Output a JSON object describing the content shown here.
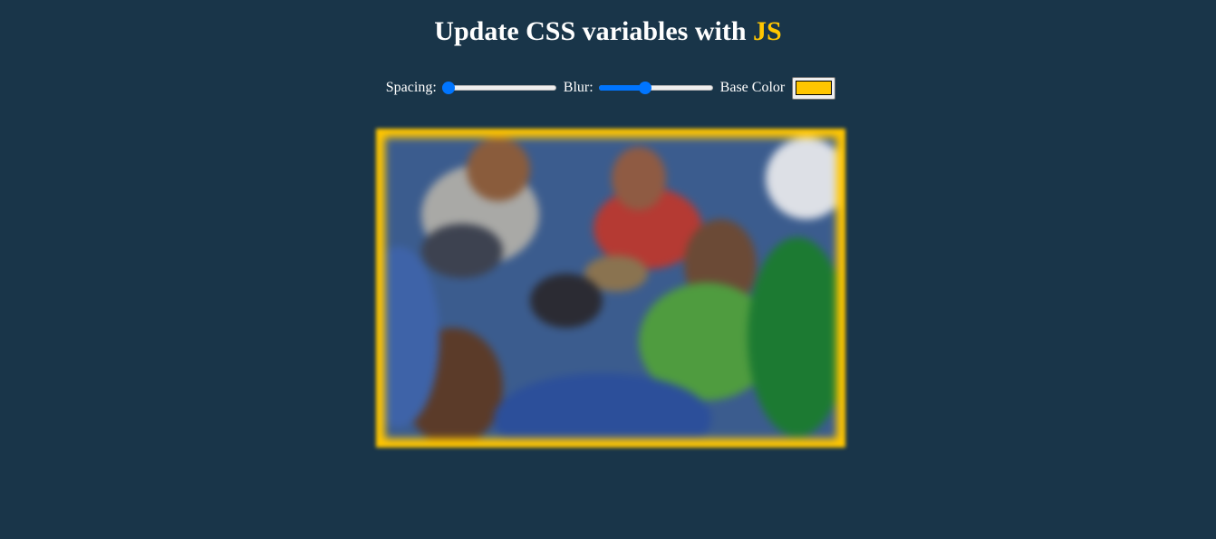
{
  "header": {
    "title_prefix": "Update CSS variables with ",
    "title_highlight": "JS"
  },
  "controls": {
    "spacing_label": "Spacing:",
    "spacing_value": 10,
    "spacing_min": 10,
    "spacing_max": 200,
    "blur_label": "Blur:",
    "blur_value": 10,
    "blur_min": 0,
    "blur_max": 25,
    "base_color_label": "Base Color",
    "base_color_value": "#ffc600"
  },
  "colors": {
    "background": "#193549",
    "accent": "#ffc600",
    "slider": "#0075ff"
  },
  "image": {
    "alt": ""
  }
}
